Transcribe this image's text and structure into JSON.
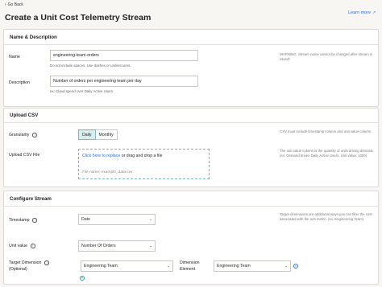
{
  "header": {
    "back_label": "Go Back",
    "title": "Create a Unit Cost Telemetry Stream",
    "learn_more": "Learn more"
  },
  "name_description": {
    "section_title": "Name & Description",
    "name_label": "Name",
    "name_value": "engineering-team-orders",
    "name_helper": "Do not include spaces. Use dashes or underscores.",
    "name_note": "WARNING: Stream name cannot be changed after stream is saved!",
    "description_label": "Description",
    "description_value": "Number of orders per engineering team per day",
    "description_helper": "ex: Cloud spend over Daily Active Users"
  },
  "upload_csv": {
    "section_title": "Upload CSV",
    "granularity_label": "Granularity",
    "granularity_options": [
      "Daily",
      "Monthly"
    ],
    "granularity_selected": "Daily",
    "granularity_note": "CSV must include timestamp column and unit value column.",
    "upload_label": "Upload CSV File",
    "upload_link": "Click here to replace",
    "upload_text": " or drag and drop a file",
    "file_name": "File name: example_data.csv",
    "upload_note": "The unit value column is the quantity of units driving demand. (ex: Demand driven Daily Active Users, Unit value: 1000)"
  },
  "configure_stream": {
    "section_title": "Configure Stream",
    "timestamp_label": "Timestamp",
    "timestamp_value": "Date",
    "timestamp_note": "Target dimensions are additional ways you can filter the cost associated with the unit metric. (ex. Engineering Team)",
    "unit_value_label": "Unit value",
    "unit_value_value": "Number Of Orders",
    "target_dimension_label": "Target Dimension",
    "target_dimension_sub": "(Optional)",
    "target_dimension_value": "Engineering Team",
    "dimension_element_label_1": "Dimension",
    "dimension_element_label_2": "Element",
    "dimension_element_value": "Engineering Team"
  },
  "colors": {
    "accent": "#2a6fdb",
    "teal": "#2a9d8f",
    "background": "#f7f6f3"
  }
}
